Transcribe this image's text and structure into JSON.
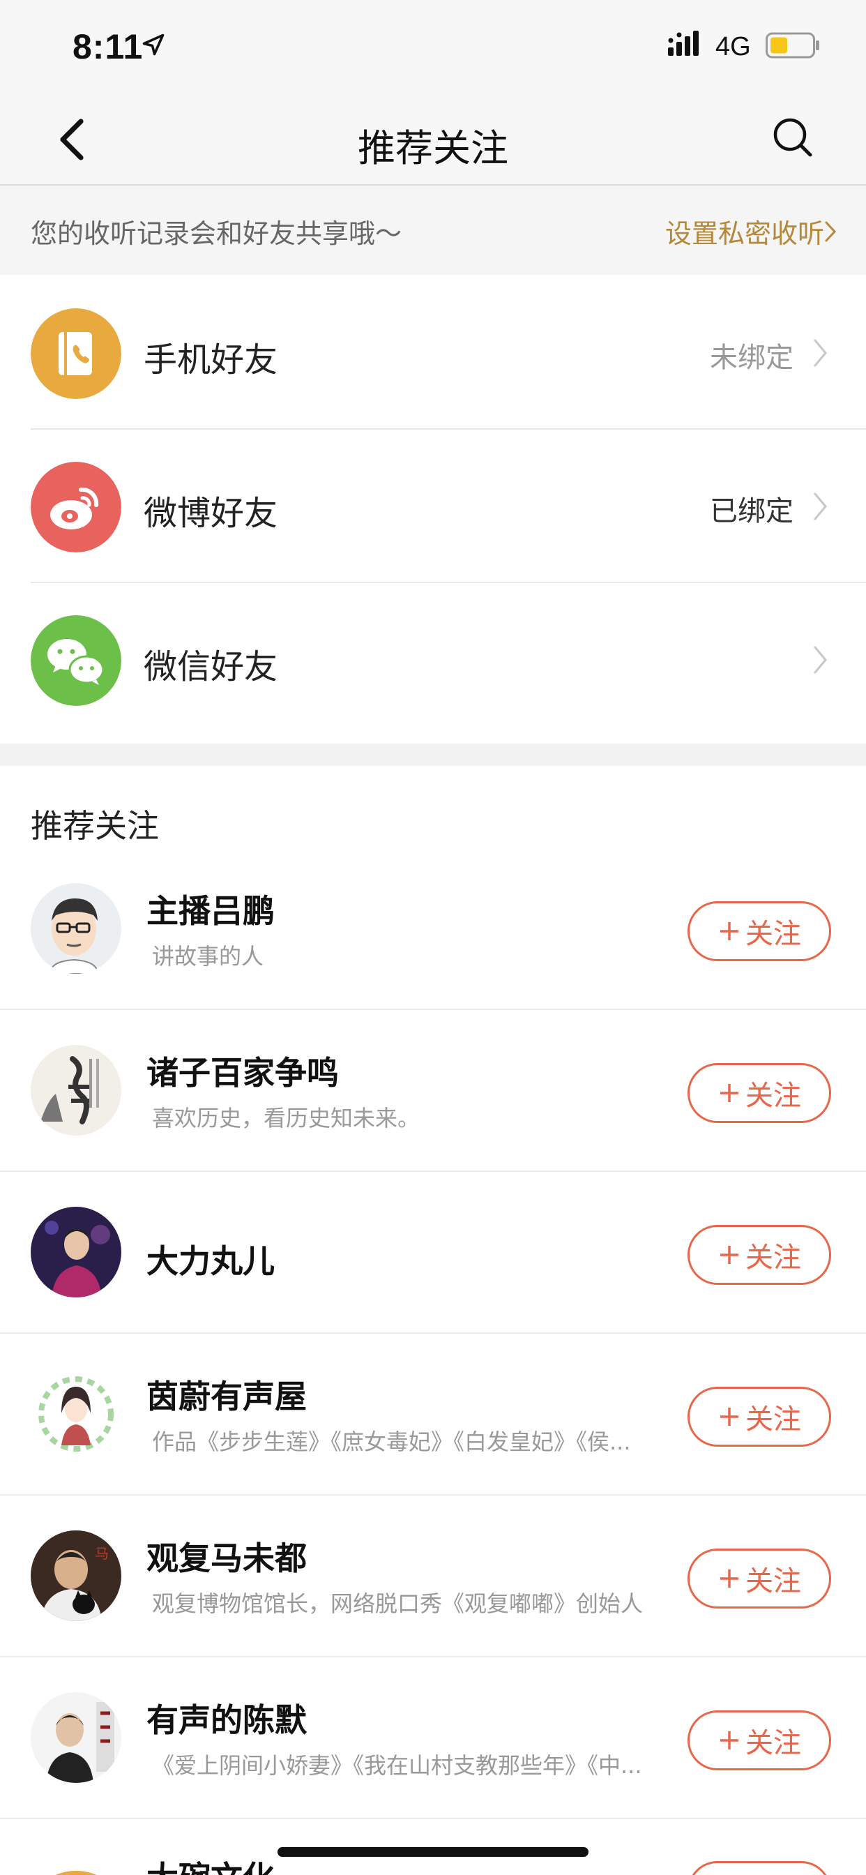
{
  "status_bar": {
    "time": "8:11",
    "network": "4G",
    "battery_color": "#f5c518"
  },
  "nav": {
    "title": "推荐关注",
    "back_icon": "back-chevron-icon",
    "search_icon": "search-icon"
  },
  "notice": {
    "text": "您的收听记录会和好友共享哦～",
    "link": "设置私密收听"
  },
  "friends": [
    {
      "label": "手机好友",
      "status": "未绑定",
      "icon": "phone-book-icon",
      "color": "#e8a93e",
      "status_color": "#999999"
    },
    {
      "label": "微博好友",
      "status": "已绑定",
      "icon": "weibo-icon",
      "color": "#e9635e",
      "status_color": "#333333"
    },
    {
      "label": "微信好友",
      "status": "",
      "icon": "wechat-icon",
      "color": "#6cc04a",
      "status_color": "#999999"
    }
  ],
  "recommend": {
    "title": "推荐关注",
    "follow_label": "关注",
    "items": [
      {
        "name": "主播吕鹏",
        "desc": "讲故事的人"
      },
      {
        "name": "诸子百家争鸣",
        "desc": "喜欢历史，看历史知未来。"
      },
      {
        "name": "大力丸儿",
        "desc": ""
      },
      {
        "name": "茵蔚有声屋",
        "desc": "作品《步步生莲》《庶女毒妃》《白发皇妃》《侯..."
      },
      {
        "name": "观复马未都",
        "desc": "观复博物馆馆长，网络脱口秀《观复嘟嘟》创始人"
      },
      {
        "name": "有声的陈默",
        "desc": "《爱上阴间小娇妻》《我在山村支教那些年》《中..."
      },
      {
        "name": "大碗文化",
        "desc": ""
      }
    ]
  },
  "accent_color": "#e8664a"
}
